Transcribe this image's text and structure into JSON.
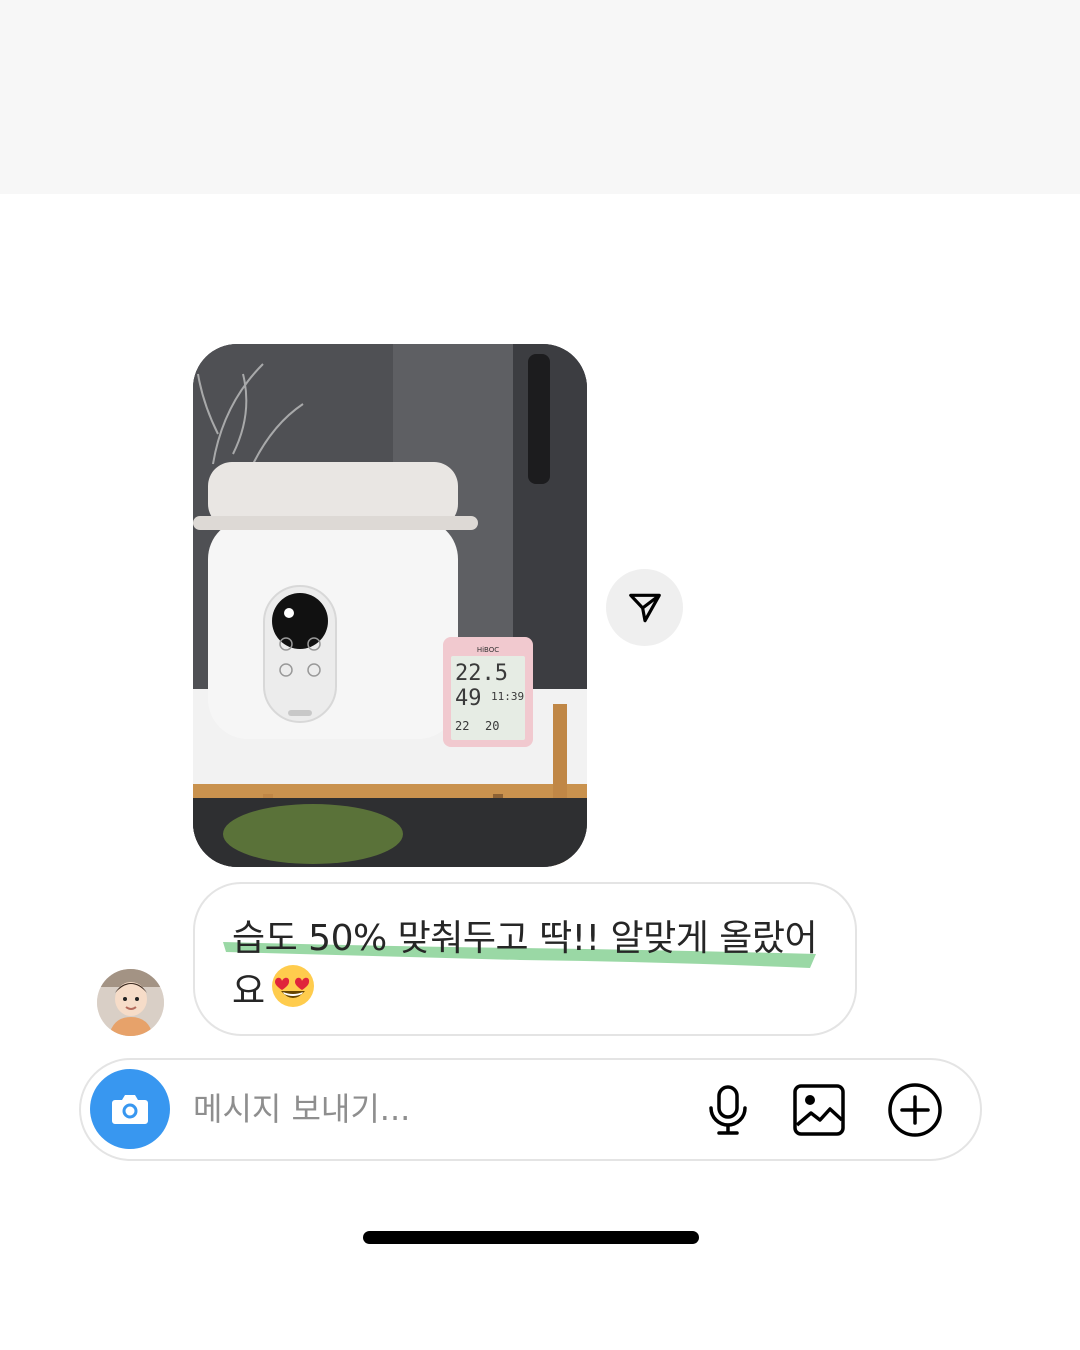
{
  "thread": {
    "photo_message": {
      "kind": "image",
      "alt": "",
      "thermo_brand": "HiBOC",
      "thermo_temp": "22.5",
      "thermo_humidity": "49",
      "thermo_time": "11:39",
      "thermo_min": "22",
      "thermo_max": "20"
    },
    "text_message": {
      "line1": "습도 50% 맞춰두고 딱!! 알맞게 올랐어",
      "line2": "요",
      "emoji": "heart-eyes-emoji",
      "highlight_color": "#8fd49b"
    },
    "share_icon": "paper-plane-icon"
  },
  "composer": {
    "placeholder": "메시지 보내기...",
    "camera_icon": "camera-icon",
    "mic_icon": "microphone-icon",
    "gallery_icon": "gallery-icon",
    "add_icon": "add-circle-icon",
    "accent": "#3897f0"
  }
}
